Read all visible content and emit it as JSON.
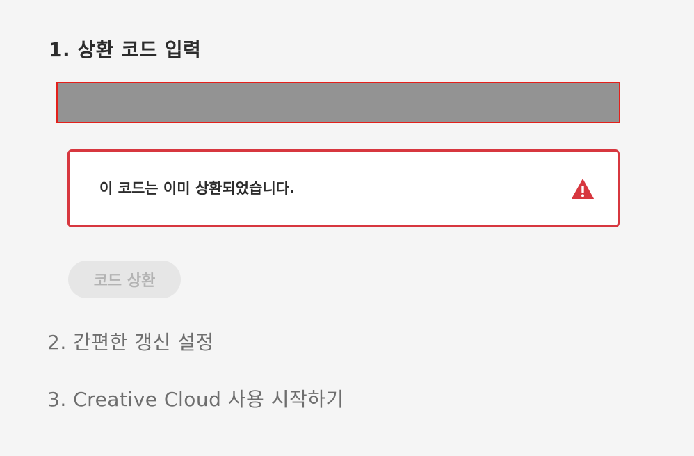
{
  "steps": {
    "step1": {
      "title": "1. 상환 코드 입력"
    },
    "step2": {
      "title": "2. 간편한 갱신 설정"
    },
    "step3": {
      "title": "3. Creative Cloud 사용 시작하기"
    }
  },
  "code_input": {
    "value": "",
    "state": "error",
    "border_color": "#e3201b"
  },
  "error": {
    "message": "이 코드는 이미 상환되었습니다.",
    "icon": "alert-triangle-icon",
    "color": "#d7373f"
  },
  "redeem_button": {
    "label": "코드 상환",
    "enabled": false
  }
}
